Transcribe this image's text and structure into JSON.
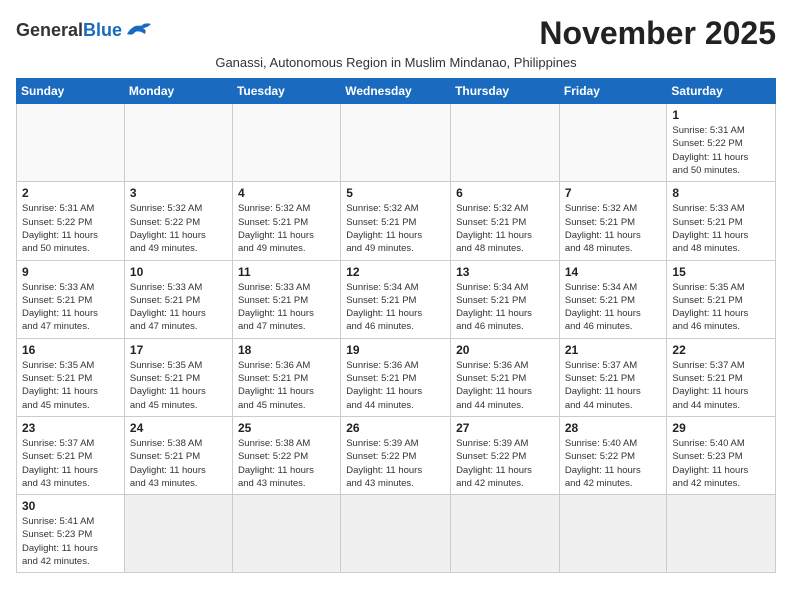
{
  "logo": {
    "general": "General",
    "blue": "Blue"
  },
  "title": "November 2025",
  "subtitle": "Ganassi, Autonomous Region in Muslim Mindanao, Philippines",
  "days_of_week": [
    "Sunday",
    "Monday",
    "Tuesday",
    "Wednesday",
    "Thursday",
    "Friday",
    "Saturday"
  ],
  "weeks": [
    [
      {
        "day": "",
        "info": ""
      },
      {
        "day": "",
        "info": ""
      },
      {
        "day": "",
        "info": ""
      },
      {
        "day": "",
        "info": ""
      },
      {
        "day": "",
        "info": ""
      },
      {
        "day": "",
        "info": ""
      },
      {
        "day": "1",
        "info": "Sunrise: 5:31 AM\nSunset: 5:22 PM\nDaylight: 11 hours\nand 50 minutes."
      }
    ],
    [
      {
        "day": "2",
        "info": "Sunrise: 5:31 AM\nSunset: 5:22 PM\nDaylight: 11 hours\nand 50 minutes."
      },
      {
        "day": "3",
        "info": "Sunrise: 5:32 AM\nSunset: 5:22 PM\nDaylight: 11 hours\nand 49 minutes."
      },
      {
        "day": "4",
        "info": "Sunrise: 5:32 AM\nSunset: 5:21 PM\nDaylight: 11 hours\nand 49 minutes."
      },
      {
        "day": "5",
        "info": "Sunrise: 5:32 AM\nSunset: 5:21 PM\nDaylight: 11 hours\nand 49 minutes."
      },
      {
        "day": "6",
        "info": "Sunrise: 5:32 AM\nSunset: 5:21 PM\nDaylight: 11 hours\nand 48 minutes."
      },
      {
        "day": "7",
        "info": "Sunrise: 5:32 AM\nSunset: 5:21 PM\nDaylight: 11 hours\nand 48 minutes."
      },
      {
        "day": "8",
        "info": "Sunrise: 5:33 AM\nSunset: 5:21 PM\nDaylight: 11 hours\nand 48 minutes."
      }
    ],
    [
      {
        "day": "9",
        "info": "Sunrise: 5:33 AM\nSunset: 5:21 PM\nDaylight: 11 hours\nand 47 minutes."
      },
      {
        "day": "10",
        "info": "Sunrise: 5:33 AM\nSunset: 5:21 PM\nDaylight: 11 hours\nand 47 minutes."
      },
      {
        "day": "11",
        "info": "Sunrise: 5:33 AM\nSunset: 5:21 PM\nDaylight: 11 hours\nand 47 minutes."
      },
      {
        "day": "12",
        "info": "Sunrise: 5:34 AM\nSunset: 5:21 PM\nDaylight: 11 hours\nand 46 minutes."
      },
      {
        "day": "13",
        "info": "Sunrise: 5:34 AM\nSunset: 5:21 PM\nDaylight: 11 hours\nand 46 minutes."
      },
      {
        "day": "14",
        "info": "Sunrise: 5:34 AM\nSunset: 5:21 PM\nDaylight: 11 hours\nand 46 minutes."
      },
      {
        "day": "15",
        "info": "Sunrise: 5:35 AM\nSunset: 5:21 PM\nDaylight: 11 hours\nand 46 minutes."
      }
    ],
    [
      {
        "day": "16",
        "info": "Sunrise: 5:35 AM\nSunset: 5:21 PM\nDaylight: 11 hours\nand 45 minutes."
      },
      {
        "day": "17",
        "info": "Sunrise: 5:35 AM\nSunset: 5:21 PM\nDaylight: 11 hours\nand 45 minutes."
      },
      {
        "day": "18",
        "info": "Sunrise: 5:36 AM\nSunset: 5:21 PM\nDaylight: 11 hours\nand 45 minutes."
      },
      {
        "day": "19",
        "info": "Sunrise: 5:36 AM\nSunset: 5:21 PM\nDaylight: 11 hours\nand 44 minutes."
      },
      {
        "day": "20",
        "info": "Sunrise: 5:36 AM\nSunset: 5:21 PM\nDaylight: 11 hours\nand 44 minutes."
      },
      {
        "day": "21",
        "info": "Sunrise: 5:37 AM\nSunset: 5:21 PM\nDaylight: 11 hours\nand 44 minutes."
      },
      {
        "day": "22",
        "info": "Sunrise: 5:37 AM\nSunset: 5:21 PM\nDaylight: 11 hours\nand 44 minutes."
      }
    ],
    [
      {
        "day": "23",
        "info": "Sunrise: 5:37 AM\nSunset: 5:21 PM\nDaylight: 11 hours\nand 43 minutes."
      },
      {
        "day": "24",
        "info": "Sunrise: 5:38 AM\nSunset: 5:21 PM\nDaylight: 11 hours\nand 43 minutes."
      },
      {
        "day": "25",
        "info": "Sunrise: 5:38 AM\nSunset: 5:22 PM\nDaylight: 11 hours\nand 43 minutes."
      },
      {
        "day": "26",
        "info": "Sunrise: 5:39 AM\nSunset: 5:22 PM\nDaylight: 11 hours\nand 43 minutes."
      },
      {
        "day": "27",
        "info": "Sunrise: 5:39 AM\nSunset: 5:22 PM\nDaylight: 11 hours\nand 42 minutes."
      },
      {
        "day": "28",
        "info": "Sunrise: 5:40 AM\nSunset: 5:22 PM\nDaylight: 11 hours\nand 42 minutes."
      },
      {
        "day": "29",
        "info": "Sunrise: 5:40 AM\nSunset: 5:23 PM\nDaylight: 11 hours\nand 42 minutes."
      }
    ],
    [
      {
        "day": "30",
        "info": "Sunrise: 5:41 AM\nSunset: 5:23 PM\nDaylight: 11 hours\nand 42 minutes."
      },
      {
        "day": "",
        "info": ""
      },
      {
        "day": "",
        "info": ""
      },
      {
        "day": "",
        "info": ""
      },
      {
        "day": "",
        "info": ""
      },
      {
        "day": "",
        "info": ""
      },
      {
        "day": "",
        "info": ""
      }
    ]
  ]
}
